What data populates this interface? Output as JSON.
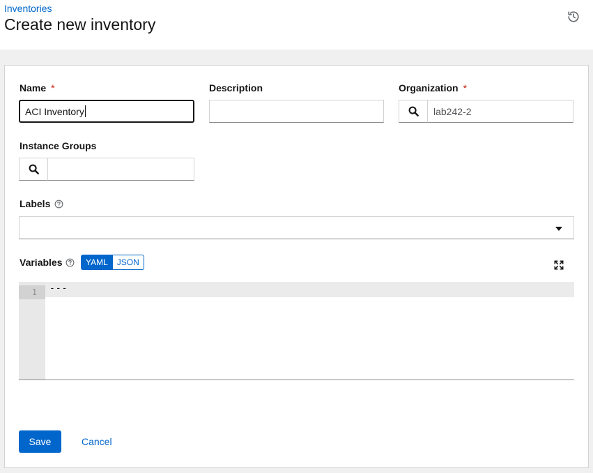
{
  "header": {
    "breadcrumb": "Inventories",
    "title": "Create new inventory",
    "history_icon": "history-icon"
  },
  "form": {
    "name": {
      "label": "Name",
      "required_mark": "*",
      "value": "ACI Inventory"
    },
    "description": {
      "label": "Description",
      "value": ""
    },
    "organization": {
      "label": "Organization",
      "required_mark": "*",
      "value": "lab242-2",
      "icon": "search-icon"
    },
    "instance_groups": {
      "label": "Instance Groups",
      "value": "",
      "icon": "search-icon"
    },
    "labels": {
      "label": "Labels",
      "help_icon": "question-circle-icon",
      "value": "",
      "dropdown_icon": "caret-down-icon"
    },
    "variables": {
      "label": "Variables",
      "help_icon": "question-circle-icon",
      "modes": [
        "YAML",
        "JSON"
      ],
      "active_mode": "YAML",
      "expand_icon": "expand-icon",
      "editor": {
        "line_numbers": [
          "1"
        ],
        "lines": [
          "---"
        ]
      }
    }
  },
  "actions": {
    "save_label": "Save",
    "cancel_label": "Cancel"
  },
  "colors": {
    "accent": "#0066cc",
    "required": "#c9190b",
    "background": "#f0f0f0"
  }
}
